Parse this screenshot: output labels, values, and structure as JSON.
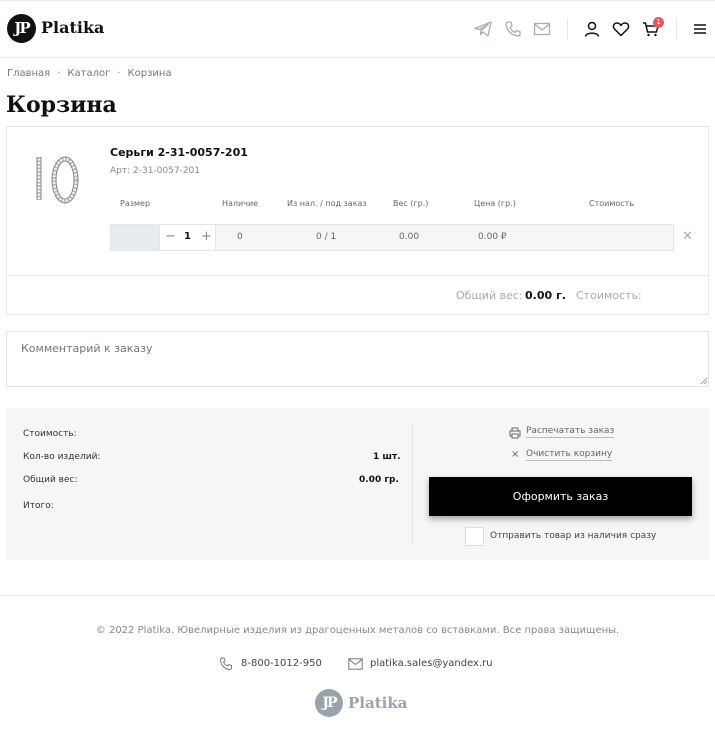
{
  "header": {
    "logo_mark": "JP",
    "logo_text": "Platika",
    "cart_count": "1",
    "icons": [
      "telegram-icon",
      "phone-icon",
      "mail-icon",
      "user-icon",
      "heart-icon",
      "cart-icon",
      "menu-icon"
    ]
  },
  "breadcrumb": [
    "Главная",
    "Каталог",
    "Корзина"
  ],
  "page_title": "Корзина",
  "product": {
    "name": "Серьги 2-31-0057-201",
    "sku": "Арт: 2-31-0057-201",
    "columns": [
      "Размер",
      "Наличие",
      "Из нал. / под заказ",
      "Вес (гр.)",
      "Цена (гр.)",
      "Стоимость"
    ],
    "qty_minus": "−",
    "qty": "1",
    "qty_plus": "+",
    "availability": "0",
    "stock_order_a": "0",
    "stock_order_sep": " / ",
    "stock_order_b": "1",
    "weight": "0.00",
    "price": "0.00 ₽",
    "remove": "✕"
  },
  "totals": {
    "weight_label": "Общий вес:",
    "weight_value": "0.00 г.",
    "cost_label": "Стоимость:"
  },
  "comment": {
    "placeholder": "Комментарий к заказу"
  },
  "summary": {
    "cost_label": "Стоимость:",
    "count_label": "Кол-во изделий:",
    "count_value": "1 шт.",
    "weight_label": "Общий вес:",
    "weight_value": "0.00 гр.",
    "total_label": "Итого:",
    "print_label": "Распечатать заказ",
    "clear_icon": "×",
    "clear_label": "Очистить корзину",
    "order_button": "Оформить заказ",
    "checkbox_label": "Отправить товар из наличия сразу"
  },
  "footer": {
    "copyright": "© 2022 Platika. Ювелирные изделия из драгоценных металов со вставками. Все права защищены.",
    "phone": "8-800-1012-950",
    "email": "platika.sales@yandex.ru",
    "logo_mark": "JP",
    "logo_text": "Platika"
  },
  "colors": {
    "accent": "#000000",
    "badge": "#e4595a",
    "panel": "#f5f6f7"
  }
}
